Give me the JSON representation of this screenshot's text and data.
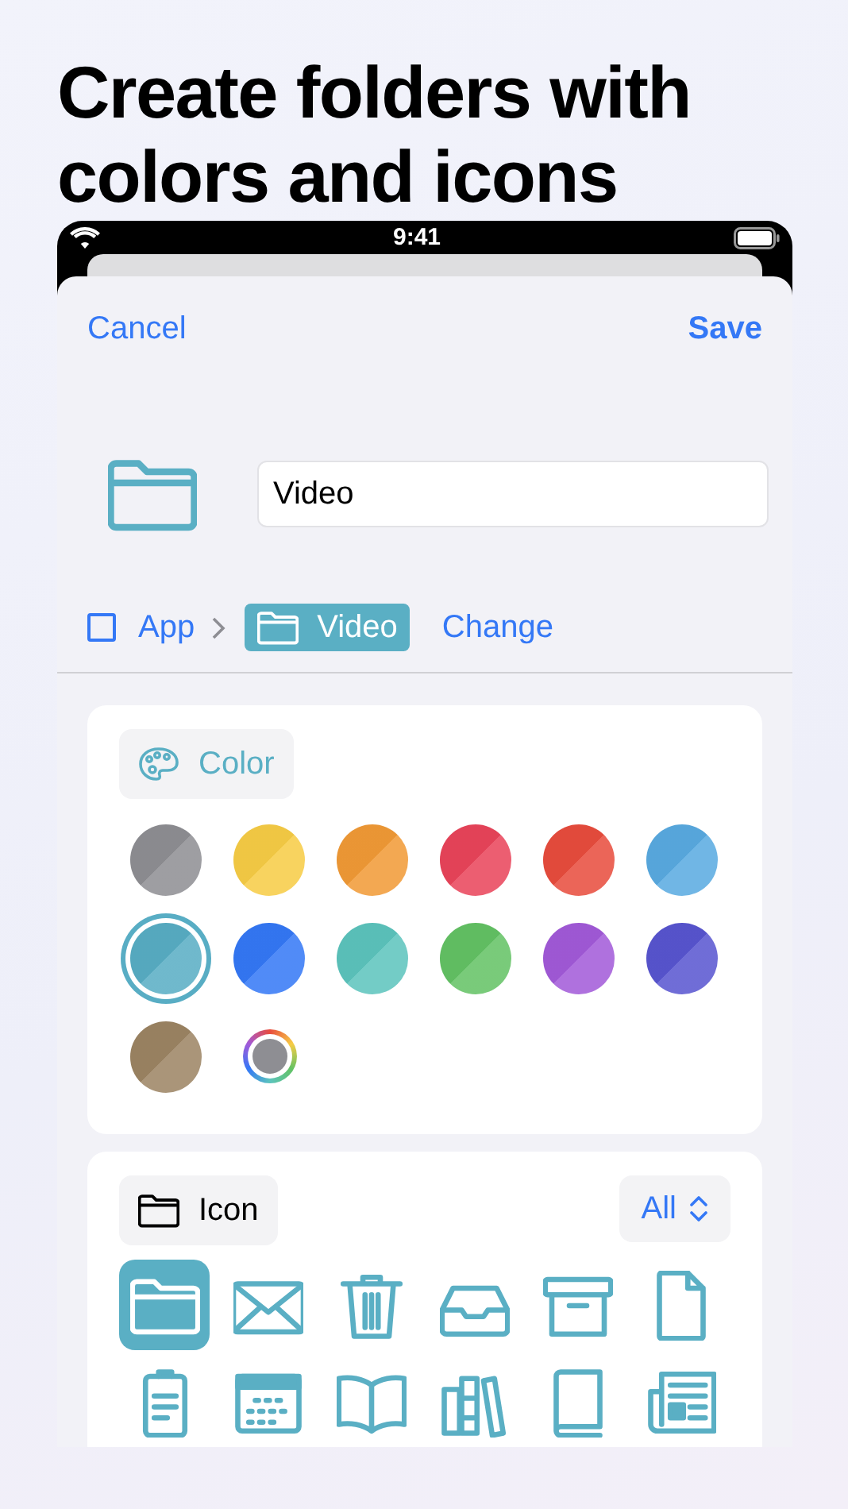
{
  "headline": "Create folders with colors and icons",
  "status_bar": {
    "time": "9:41"
  },
  "nav": {
    "cancel": "Cancel",
    "save": "Save"
  },
  "folder": {
    "name": "Video"
  },
  "breadcrumb": {
    "parent": "App",
    "current": "Video",
    "change": "Change"
  },
  "color_section": {
    "title": "Color",
    "swatches": [
      {
        "kind": "swatch",
        "color": "#8e8e93",
        "selected": false
      },
      {
        "kind": "swatch",
        "color": "#f7cc45",
        "selected": false
      },
      {
        "kind": "swatch",
        "color": "#f19a36",
        "selected": false
      },
      {
        "kind": "swatch",
        "color": "#e9445a",
        "selected": false
      },
      {
        "kind": "swatch",
        "color": "#e84c3d",
        "selected": false
      },
      {
        "kind": "swatch",
        "color": "#59aae1",
        "selected": false
      },
      {
        "kind": "swatch",
        "color": "#58adc4",
        "selected": true
      },
      {
        "kind": "swatch",
        "color": "#3478f6",
        "selected": false
      },
      {
        "kind": "swatch",
        "color": "#5cc4bd",
        "selected": false
      },
      {
        "kind": "swatch",
        "color": "#63c264",
        "selected": false
      },
      {
        "kind": "swatch",
        "color": "#a25ad9",
        "selected": false
      },
      {
        "kind": "swatch",
        "color": "#5855d0",
        "selected": false
      },
      {
        "kind": "swatch",
        "color": "#9c8463",
        "selected": false
      },
      {
        "kind": "custom",
        "selected": false
      }
    ]
  },
  "icon_section": {
    "title": "Icon",
    "filter": "All",
    "icons": [
      {
        "kind": "folder",
        "selected": true
      },
      {
        "kind": "envelope",
        "selected": false
      },
      {
        "kind": "trash",
        "selected": false
      },
      {
        "kind": "tray",
        "selected": false
      },
      {
        "kind": "archive",
        "selected": false
      },
      {
        "kind": "document",
        "selected": false
      },
      {
        "kind": "clipboard",
        "selected": false
      },
      {
        "kind": "calendar",
        "selected": false
      },
      {
        "kind": "book-open",
        "selected": false
      },
      {
        "kind": "books",
        "selected": false
      },
      {
        "kind": "book",
        "selected": false
      },
      {
        "kind": "newspaper",
        "selected": false
      }
    ]
  }
}
